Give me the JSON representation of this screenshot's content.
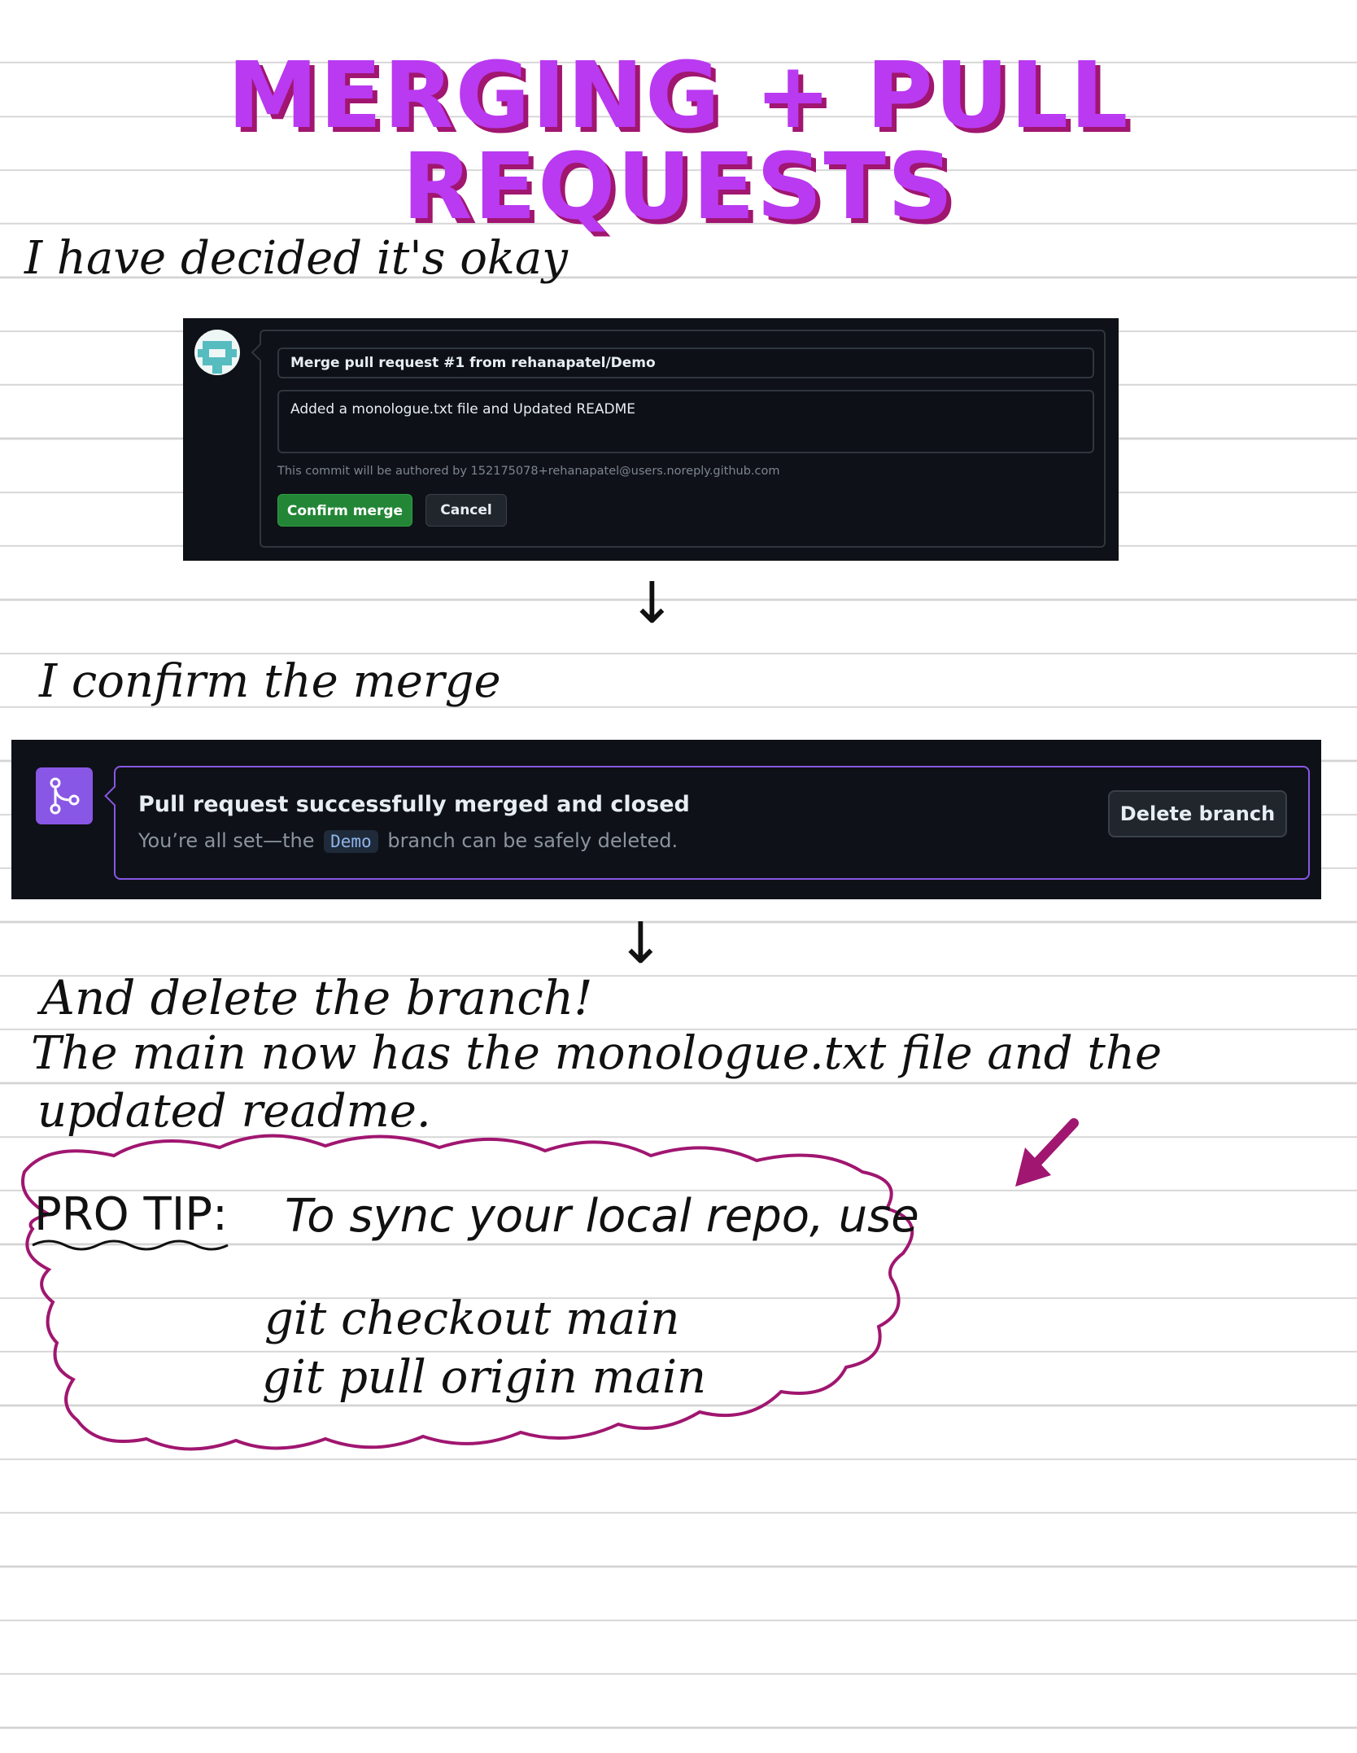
{
  "title": "MERGING + PULL REQUESTS",
  "notes": {
    "decided": "I have decided it's okay",
    "confirm": "I confirm the merge",
    "delete": "And delete the branch!",
    "main_line1": "The main now has the monologue.txt file and the",
    "main_line2": "updated readme."
  },
  "arrows": {
    "down": "↓"
  },
  "merge_form": {
    "commit_title": "Merge pull request #1 from rehanapatel/Demo",
    "commit_body": "Added a monologue.txt file and Updated README",
    "author_note": "This commit will be authored by 152175078+rehanapatel@users.noreply.github.com",
    "confirm_label": "Confirm merge",
    "cancel_label": "Cancel"
  },
  "merged_banner": {
    "icon": "git-merge-icon",
    "title": "Pull request successfully merged and closed",
    "subtitle_before": "You’re all set—the",
    "branch_name": "Demo",
    "subtitle_after": "branch can be safely deleted.",
    "delete_label": "Delete branch"
  },
  "pro_tip": {
    "label": "PRO TIP:",
    "text": "To sync your local repo, use",
    "commands": [
      "git checkout main",
      "git pull origin main"
    ]
  },
  "colors": {
    "title_fill": "#b93af0",
    "title_shadow": "#a01670",
    "cloud_stroke": "#a01670",
    "merge_purple": "#8957e5",
    "confirm_green": "#238636",
    "dark_bg": "#0e1117"
  }
}
